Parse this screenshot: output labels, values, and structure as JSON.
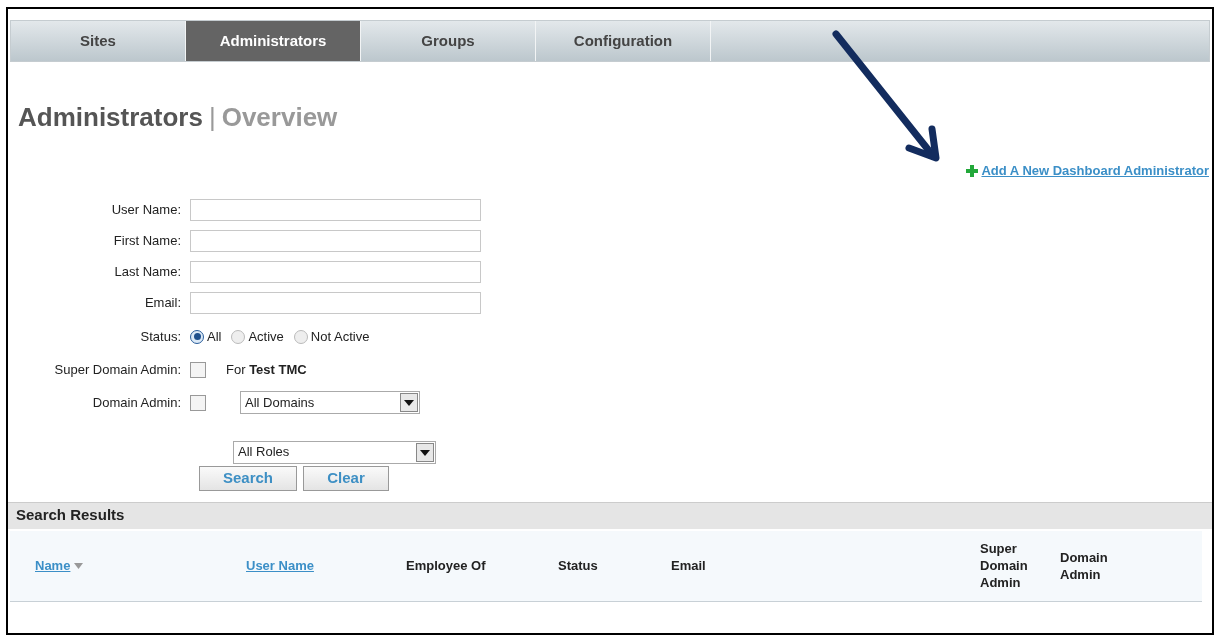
{
  "tabs": [
    {
      "label": "Sites",
      "selected": false
    },
    {
      "label": "Administrators",
      "selected": true
    },
    {
      "label": "Groups",
      "selected": false
    },
    {
      "label": "Configuration",
      "selected": false
    }
  ],
  "heading": {
    "title": "Administrators",
    "separator": "|",
    "subtitle": "Overview"
  },
  "add_link": "Add A New Dashboard Administrator",
  "text_fields": [
    {
      "label": "User Name:"
    },
    {
      "label": "First Name:"
    },
    {
      "label": "Last Name:"
    },
    {
      "label": "Email:"
    }
  ],
  "status": {
    "label": "Status:",
    "options": [
      {
        "label": "All",
        "selected": true
      },
      {
        "label": "Active",
        "selected": false
      },
      {
        "label": "Not Active",
        "selected": false
      }
    ]
  },
  "super_domain_admin": {
    "label": "Super Domain Admin:",
    "checked": false,
    "note": "For **Test TMC**"
  },
  "domain_admin": {
    "label": "Domain Admin:",
    "checked": false,
    "dropdown": "All Domains"
  },
  "roles_dropdown": "All Roles",
  "buttons": [
    "Search",
    "Clear"
  ],
  "results": {
    "title": "Search Results",
    "columns": [
      {
        "label": "Name",
        "kind": "link",
        "sorted": true
      },
      {
        "label": "User Name",
        "kind": "link",
        "sorted": false
      },
      {
        "label": "Employee Of",
        "kind": "plain",
        "sorted": false
      },
      {
        "label": "Status",
        "kind": "plain",
        "sorted": false
      },
      {
        "label": "Email",
        "kind": "plain",
        "sorted": false
      },
      {
        "label": "Super Domain Admin",
        "kind": "plain",
        "sorted": false
      },
      {
        "label": "Domain Admin",
        "kind": "plain",
        "sorted": false
      }
    ]
  }
}
